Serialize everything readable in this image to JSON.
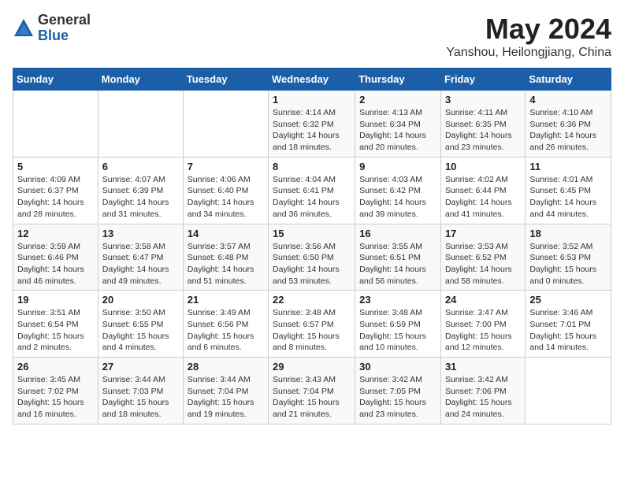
{
  "header": {
    "logo": {
      "general": "General",
      "blue": "Blue"
    },
    "title": "May 2024",
    "location": "Yanshou, Heilongjiang, China"
  },
  "weekdays": [
    "Sunday",
    "Monday",
    "Tuesday",
    "Wednesday",
    "Thursday",
    "Friday",
    "Saturday"
  ],
  "weeks": [
    [
      {
        "day": "",
        "info": ""
      },
      {
        "day": "",
        "info": ""
      },
      {
        "day": "",
        "info": ""
      },
      {
        "day": "1",
        "info": "Sunrise: 4:14 AM\nSunset: 6:32 PM\nDaylight: 14 hours\nand 18 minutes."
      },
      {
        "day": "2",
        "info": "Sunrise: 4:13 AM\nSunset: 6:34 PM\nDaylight: 14 hours\nand 20 minutes."
      },
      {
        "day": "3",
        "info": "Sunrise: 4:11 AM\nSunset: 6:35 PM\nDaylight: 14 hours\nand 23 minutes."
      },
      {
        "day": "4",
        "info": "Sunrise: 4:10 AM\nSunset: 6:36 PM\nDaylight: 14 hours\nand 26 minutes."
      }
    ],
    [
      {
        "day": "5",
        "info": "Sunrise: 4:09 AM\nSunset: 6:37 PM\nDaylight: 14 hours\nand 28 minutes."
      },
      {
        "day": "6",
        "info": "Sunrise: 4:07 AM\nSunset: 6:39 PM\nDaylight: 14 hours\nand 31 minutes."
      },
      {
        "day": "7",
        "info": "Sunrise: 4:06 AM\nSunset: 6:40 PM\nDaylight: 14 hours\nand 34 minutes."
      },
      {
        "day": "8",
        "info": "Sunrise: 4:04 AM\nSunset: 6:41 PM\nDaylight: 14 hours\nand 36 minutes."
      },
      {
        "day": "9",
        "info": "Sunrise: 4:03 AM\nSunset: 6:42 PM\nDaylight: 14 hours\nand 39 minutes."
      },
      {
        "day": "10",
        "info": "Sunrise: 4:02 AM\nSunset: 6:44 PM\nDaylight: 14 hours\nand 41 minutes."
      },
      {
        "day": "11",
        "info": "Sunrise: 4:01 AM\nSunset: 6:45 PM\nDaylight: 14 hours\nand 44 minutes."
      }
    ],
    [
      {
        "day": "12",
        "info": "Sunrise: 3:59 AM\nSunset: 6:46 PM\nDaylight: 14 hours\nand 46 minutes."
      },
      {
        "day": "13",
        "info": "Sunrise: 3:58 AM\nSunset: 6:47 PM\nDaylight: 14 hours\nand 49 minutes."
      },
      {
        "day": "14",
        "info": "Sunrise: 3:57 AM\nSunset: 6:48 PM\nDaylight: 14 hours\nand 51 minutes."
      },
      {
        "day": "15",
        "info": "Sunrise: 3:56 AM\nSunset: 6:50 PM\nDaylight: 14 hours\nand 53 minutes."
      },
      {
        "day": "16",
        "info": "Sunrise: 3:55 AM\nSunset: 6:51 PM\nDaylight: 14 hours\nand 56 minutes."
      },
      {
        "day": "17",
        "info": "Sunrise: 3:53 AM\nSunset: 6:52 PM\nDaylight: 14 hours\nand 58 minutes."
      },
      {
        "day": "18",
        "info": "Sunrise: 3:52 AM\nSunset: 6:53 PM\nDaylight: 15 hours\nand 0 minutes."
      }
    ],
    [
      {
        "day": "19",
        "info": "Sunrise: 3:51 AM\nSunset: 6:54 PM\nDaylight: 15 hours\nand 2 minutes."
      },
      {
        "day": "20",
        "info": "Sunrise: 3:50 AM\nSunset: 6:55 PM\nDaylight: 15 hours\nand 4 minutes."
      },
      {
        "day": "21",
        "info": "Sunrise: 3:49 AM\nSunset: 6:56 PM\nDaylight: 15 hours\nand 6 minutes."
      },
      {
        "day": "22",
        "info": "Sunrise: 3:48 AM\nSunset: 6:57 PM\nDaylight: 15 hours\nand 8 minutes."
      },
      {
        "day": "23",
        "info": "Sunrise: 3:48 AM\nSunset: 6:59 PM\nDaylight: 15 hours\nand 10 minutes."
      },
      {
        "day": "24",
        "info": "Sunrise: 3:47 AM\nSunset: 7:00 PM\nDaylight: 15 hours\nand 12 minutes."
      },
      {
        "day": "25",
        "info": "Sunrise: 3:46 AM\nSunset: 7:01 PM\nDaylight: 15 hours\nand 14 minutes."
      }
    ],
    [
      {
        "day": "26",
        "info": "Sunrise: 3:45 AM\nSunset: 7:02 PM\nDaylight: 15 hours\nand 16 minutes."
      },
      {
        "day": "27",
        "info": "Sunrise: 3:44 AM\nSunset: 7:03 PM\nDaylight: 15 hours\nand 18 minutes."
      },
      {
        "day": "28",
        "info": "Sunrise: 3:44 AM\nSunset: 7:04 PM\nDaylight: 15 hours\nand 19 minutes."
      },
      {
        "day": "29",
        "info": "Sunrise: 3:43 AM\nSunset: 7:04 PM\nDaylight: 15 hours\nand 21 minutes."
      },
      {
        "day": "30",
        "info": "Sunrise: 3:42 AM\nSunset: 7:05 PM\nDaylight: 15 hours\nand 23 minutes."
      },
      {
        "day": "31",
        "info": "Sunrise: 3:42 AM\nSunset: 7:06 PM\nDaylight: 15 hours\nand 24 minutes."
      },
      {
        "day": "",
        "info": ""
      }
    ]
  ]
}
